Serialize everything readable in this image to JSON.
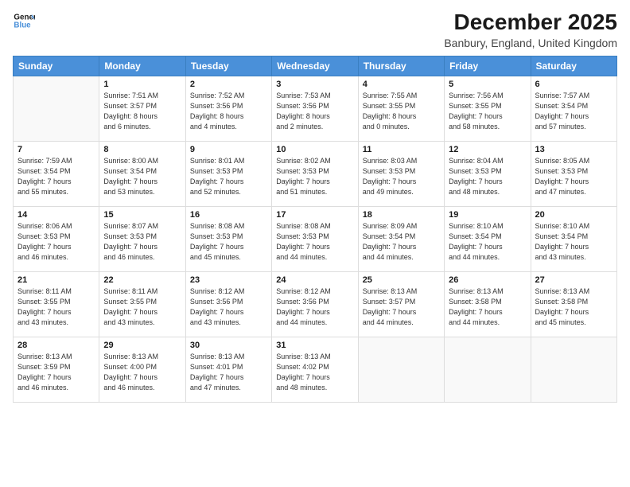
{
  "logo": {
    "line1": "General",
    "line2": "Blue"
  },
  "title": "December 2025",
  "subtitle": "Banbury, England, United Kingdom",
  "weekdays": [
    "Sunday",
    "Monday",
    "Tuesday",
    "Wednesday",
    "Thursday",
    "Friday",
    "Saturday"
  ],
  "weeks": [
    [
      {
        "day": "",
        "info": ""
      },
      {
        "day": "1",
        "info": "Sunrise: 7:51 AM\nSunset: 3:57 PM\nDaylight: 8 hours\nand 6 minutes."
      },
      {
        "day": "2",
        "info": "Sunrise: 7:52 AM\nSunset: 3:56 PM\nDaylight: 8 hours\nand 4 minutes."
      },
      {
        "day": "3",
        "info": "Sunrise: 7:53 AM\nSunset: 3:56 PM\nDaylight: 8 hours\nand 2 minutes."
      },
      {
        "day": "4",
        "info": "Sunrise: 7:55 AM\nSunset: 3:55 PM\nDaylight: 8 hours\nand 0 minutes."
      },
      {
        "day": "5",
        "info": "Sunrise: 7:56 AM\nSunset: 3:55 PM\nDaylight: 7 hours\nand 58 minutes."
      },
      {
        "day": "6",
        "info": "Sunrise: 7:57 AM\nSunset: 3:54 PM\nDaylight: 7 hours\nand 57 minutes."
      }
    ],
    [
      {
        "day": "7",
        "info": "Sunrise: 7:59 AM\nSunset: 3:54 PM\nDaylight: 7 hours\nand 55 minutes."
      },
      {
        "day": "8",
        "info": "Sunrise: 8:00 AM\nSunset: 3:54 PM\nDaylight: 7 hours\nand 53 minutes."
      },
      {
        "day": "9",
        "info": "Sunrise: 8:01 AM\nSunset: 3:53 PM\nDaylight: 7 hours\nand 52 minutes."
      },
      {
        "day": "10",
        "info": "Sunrise: 8:02 AM\nSunset: 3:53 PM\nDaylight: 7 hours\nand 51 minutes."
      },
      {
        "day": "11",
        "info": "Sunrise: 8:03 AM\nSunset: 3:53 PM\nDaylight: 7 hours\nand 49 minutes."
      },
      {
        "day": "12",
        "info": "Sunrise: 8:04 AM\nSunset: 3:53 PM\nDaylight: 7 hours\nand 48 minutes."
      },
      {
        "day": "13",
        "info": "Sunrise: 8:05 AM\nSunset: 3:53 PM\nDaylight: 7 hours\nand 47 minutes."
      }
    ],
    [
      {
        "day": "14",
        "info": "Sunrise: 8:06 AM\nSunset: 3:53 PM\nDaylight: 7 hours\nand 46 minutes."
      },
      {
        "day": "15",
        "info": "Sunrise: 8:07 AM\nSunset: 3:53 PM\nDaylight: 7 hours\nand 46 minutes."
      },
      {
        "day": "16",
        "info": "Sunrise: 8:08 AM\nSunset: 3:53 PM\nDaylight: 7 hours\nand 45 minutes."
      },
      {
        "day": "17",
        "info": "Sunrise: 8:08 AM\nSunset: 3:53 PM\nDaylight: 7 hours\nand 44 minutes."
      },
      {
        "day": "18",
        "info": "Sunrise: 8:09 AM\nSunset: 3:54 PM\nDaylight: 7 hours\nand 44 minutes."
      },
      {
        "day": "19",
        "info": "Sunrise: 8:10 AM\nSunset: 3:54 PM\nDaylight: 7 hours\nand 44 minutes."
      },
      {
        "day": "20",
        "info": "Sunrise: 8:10 AM\nSunset: 3:54 PM\nDaylight: 7 hours\nand 43 minutes."
      }
    ],
    [
      {
        "day": "21",
        "info": "Sunrise: 8:11 AM\nSunset: 3:55 PM\nDaylight: 7 hours\nand 43 minutes."
      },
      {
        "day": "22",
        "info": "Sunrise: 8:11 AM\nSunset: 3:55 PM\nDaylight: 7 hours\nand 43 minutes."
      },
      {
        "day": "23",
        "info": "Sunrise: 8:12 AM\nSunset: 3:56 PM\nDaylight: 7 hours\nand 43 minutes."
      },
      {
        "day": "24",
        "info": "Sunrise: 8:12 AM\nSunset: 3:56 PM\nDaylight: 7 hours\nand 44 minutes."
      },
      {
        "day": "25",
        "info": "Sunrise: 8:13 AM\nSunset: 3:57 PM\nDaylight: 7 hours\nand 44 minutes."
      },
      {
        "day": "26",
        "info": "Sunrise: 8:13 AM\nSunset: 3:58 PM\nDaylight: 7 hours\nand 44 minutes."
      },
      {
        "day": "27",
        "info": "Sunrise: 8:13 AM\nSunset: 3:58 PM\nDaylight: 7 hours\nand 45 minutes."
      }
    ],
    [
      {
        "day": "28",
        "info": "Sunrise: 8:13 AM\nSunset: 3:59 PM\nDaylight: 7 hours\nand 46 minutes."
      },
      {
        "day": "29",
        "info": "Sunrise: 8:13 AM\nSunset: 4:00 PM\nDaylight: 7 hours\nand 46 minutes."
      },
      {
        "day": "30",
        "info": "Sunrise: 8:13 AM\nSunset: 4:01 PM\nDaylight: 7 hours\nand 47 minutes."
      },
      {
        "day": "31",
        "info": "Sunrise: 8:13 AM\nSunset: 4:02 PM\nDaylight: 7 hours\nand 48 minutes."
      },
      {
        "day": "",
        "info": ""
      },
      {
        "day": "",
        "info": ""
      },
      {
        "day": "",
        "info": ""
      }
    ]
  ]
}
